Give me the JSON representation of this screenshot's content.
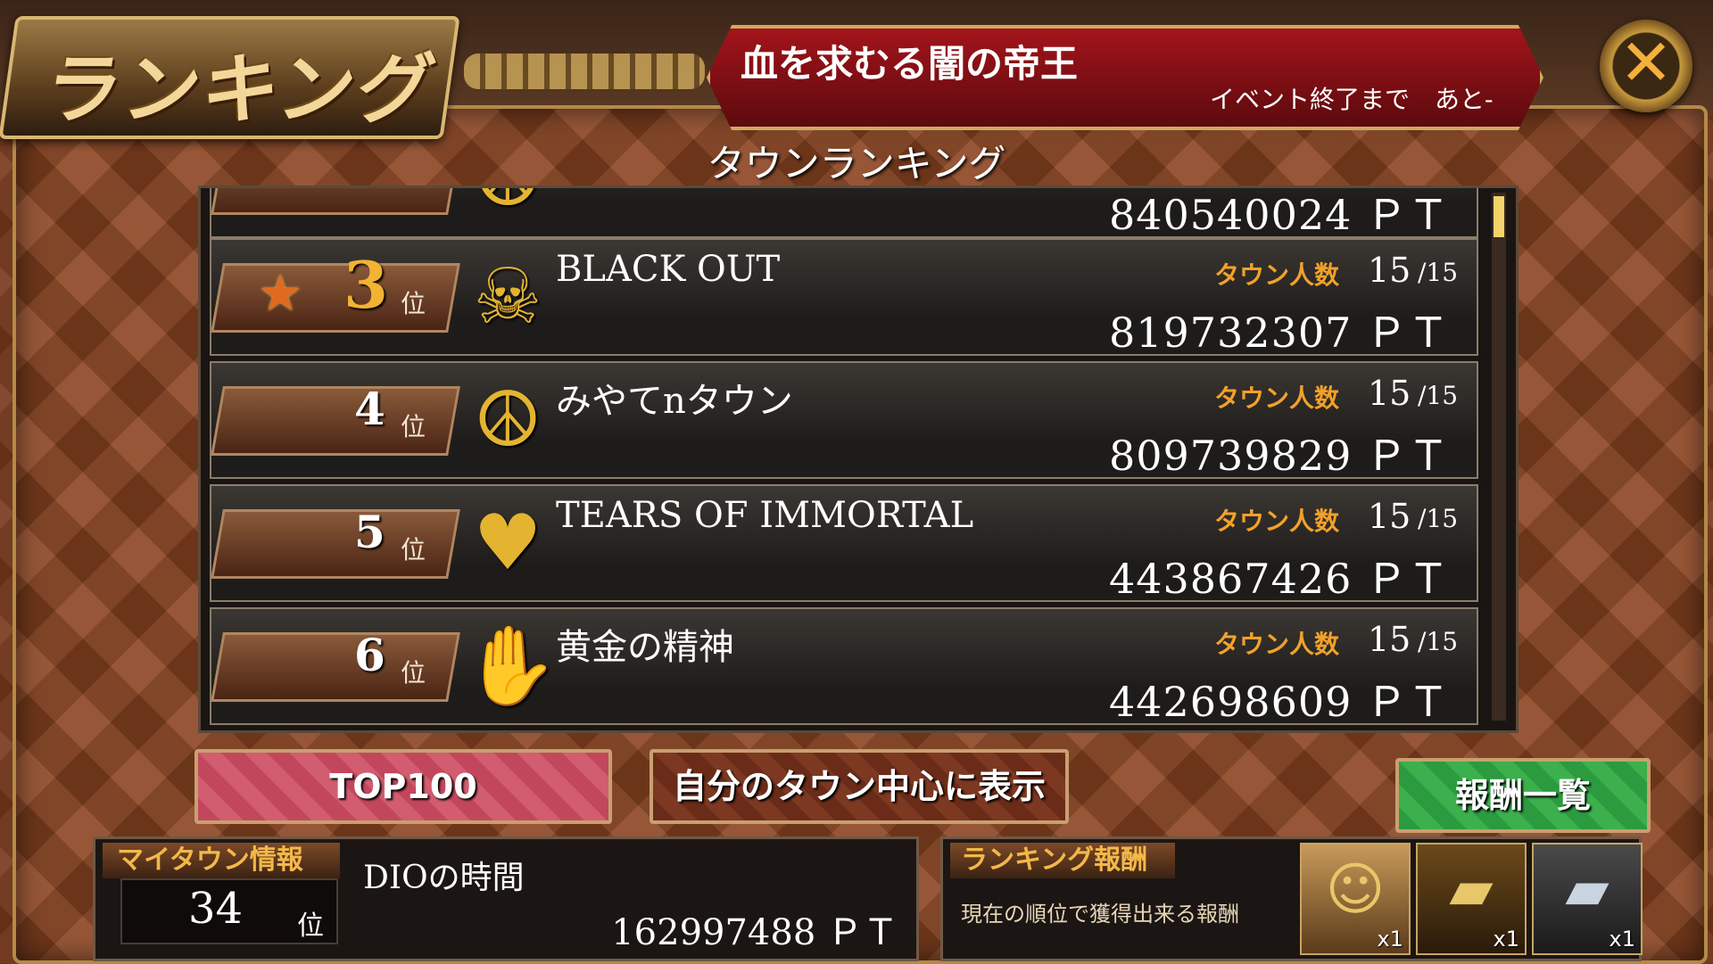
{
  "header": {
    "title": "ランキング",
    "event_title": "血を求むる闇の帝王",
    "event_remaining": "イベント終了まで　あと-",
    "close_label": "✕"
  },
  "section_title": "タウンランキング",
  "ranking": {
    "members_label": "タウン人数",
    "rank_suffix": "位",
    "points_unit": "ＰＴ",
    "partial_row": {
      "points": "840540024 ＰＴ"
    },
    "rows": [
      {
        "rank": "3",
        "emblem": "skull-icon",
        "emblem_glyph": "☠",
        "name": "BLACK OUT",
        "members": "15",
        "members_max": "/15",
        "points": "819732307 ＰＴ"
      },
      {
        "rank": "4",
        "emblem": "peace-icon",
        "emblem_glyph": "☮",
        "name": "みやてnタウン",
        "members": "15",
        "members_max": "/15",
        "points": "809739829 ＰＴ"
      },
      {
        "rank": "5",
        "emblem": "heart-icon",
        "emblem_glyph": "♥",
        "name": "TEARS OF IMMORTAL",
        "members": "15",
        "members_max": "/15",
        "points": "443867426 ＰＴ"
      },
      {
        "rank": "6",
        "emblem": "hand-icon",
        "emblem_glyph": "✋",
        "name": "黄金の精神",
        "members": "15",
        "members_max": "/15",
        "points": "442698609 ＰＴ"
      }
    ]
  },
  "buttons": {
    "top100": "TOP100",
    "center_my_town": "自分のタウン中心に表示",
    "rewards_list": "報酬一覧"
  },
  "my_town": {
    "tab_label": "マイタウン情報",
    "rank": "34",
    "rank_suffix": "位",
    "name": "DIOの時間",
    "points": "162997488 ＰＴ"
  },
  "ranking_reward": {
    "tab_label": "ランキング報酬",
    "description": "現在の順位で獲得出来る報酬",
    "items": [
      {
        "icon": "character-card-icon",
        "qty": "x1"
      },
      {
        "icon": "gold-ticket-icon",
        "qty": "x1"
      },
      {
        "icon": "silver-ticket-icon",
        "qty": "x1"
      }
    ]
  },
  "colors": {
    "accent_gold": "#f2b233",
    "members_label": "#f2a12a",
    "event_red": "#a3141b",
    "top100_pink": "#c3475c",
    "rewards_green": "#2c9a3e"
  }
}
